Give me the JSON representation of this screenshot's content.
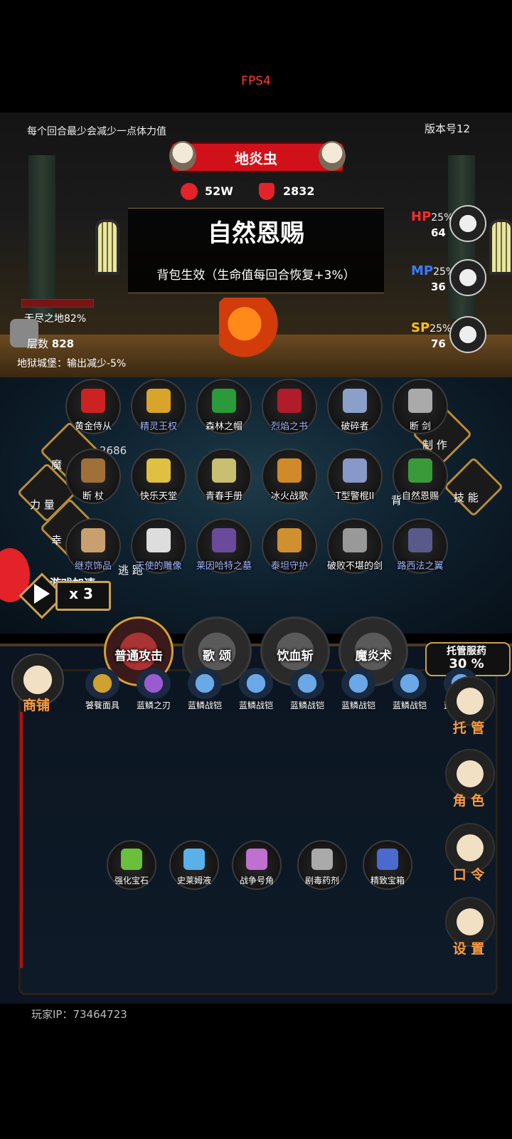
{
  "fps": "FPS4",
  "header": {
    "tip": "每个回合最少会减少一点体力值",
    "version": "版本号12"
  },
  "boss": {
    "name": "地炎虫",
    "hp": "52W",
    "def": "2832"
  },
  "buff": {
    "title": "自然恩赐",
    "desc": "背包生效（生命值每回合恢复+3%）"
  },
  "resources": {
    "hp": {
      "label": "HP",
      "pct": "25%",
      "value": "64",
      "color": "#ff2a2a"
    },
    "mp": {
      "label": "MP",
      "pct": "25%",
      "value": "36",
      "color": "#3a7bff"
    },
    "sp": {
      "label": "SP",
      "pct": "25%",
      "value": "76",
      "color": "#ffc21a"
    }
  },
  "zone": {
    "name": "无尽之地82%",
    "floor_label": "层数",
    "floor_value": "828",
    "castle": "地狱城堡：输出减少-5%"
  },
  "items": [
    {
      "label": "黄金侍从",
      "blue": false,
      "color": "#c22"
    },
    {
      "label": "精灵王权",
      "blue": true,
      "color": "#d9a42a"
    },
    {
      "label": "森林之帽",
      "blue": false,
      "color": "#2a9a3a"
    },
    {
      "label": "烈焰之书",
      "blue": true,
      "color": "#b01c2a"
    },
    {
      "label": "破碎者",
      "blue": false,
      "color": "#8aa0c8"
    },
    {
      "label": "断 剑",
      "blue": false,
      "color": "#aaa"
    },
    {
      "label": "断 杖",
      "blue": false,
      "color": "#a0703a"
    },
    {
      "label": "快乐天堂",
      "blue": false,
      "color": "#e0c040"
    },
    {
      "label": "青春手册",
      "blue": false,
      "color": "#c8c070"
    },
    {
      "label": "冰火战歌",
      "blue": false,
      "color": "#d08a2a"
    },
    {
      "label": "T型警棍II",
      "blue": false,
      "color": "#8898c8"
    },
    {
      "label": "自然恩赐",
      "blue": false,
      "color": "#3a9a3a"
    },
    {
      "label": "继京饰品",
      "blue": true,
      "color": "#c8a070"
    },
    {
      "label": "天使的雕像",
      "blue": true,
      "color": "#ddd"
    },
    {
      "label": "莱因哈特之墓",
      "blue": true,
      "color": "#6a4a9a"
    },
    {
      "label": "泰坦守护",
      "blue": true,
      "color": "#d09030"
    },
    {
      "label": "破败不堪的剑",
      "blue": false,
      "color": "#999"
    },
    {
      "label": "路西法之翼",
      "blue": true,
      "color": "#5a5a8a"
    }
  ],
  "side": {
    "craft": "制 作",
    "skill": "技 能",
    "bag": "背",
    "magic": "魔",
    "power": "力 量",
    "luck": "幸",
    "escape": "逃 跑",
    "number": "2686",
    "speed_label": "游戏加速",
    "speed_value": "x 3"
  },
  "skills": [
    {
      "label": "普通攻击"
    },
    {
      "label": "歌 颂"
    },
    {
      "label": "饮血斩"
    },
    {
      "label": "魔炎术"
    }
  ],
  "auto_med": {
    "title": "托管服药",
    "value": "30 %"
  },
  "equip_slots": [
    {
      "label": "饕餮面具",
      "color": "#d0a030"
    },
    {
      "label": "蓝鳞之刃",
      "color": "#9a5ad0"
    },
    {
      "label": "蓝鳞战铠",
      "color": "#6aa8e8"
    },
    {
      "label": "蓝鳞战铠",
      "color": "#6aa8e8"
    },
    {
      "label": "蓝鳞战铠",
      "color": "#6aa8e8"
    },
    {
      "label": "蓝鳞战铠",
      "color": "#6aa8e8"
    },
    {
      "label": "蓝鳞战铠",
      "color": "#6aa8e8"
    },
    {
      "label": "蓝鳞战铠",
      "color": "#6aa8e8"
    }
  ],
  "bag_items": [
    {
      "label": "强化宝石",
      "color": "#6ac03a"
    },
    {
      "label": "史莱姆液",
      "color": "#5ab0e8"
    },
    {
      "label": "战争号角",
      "color": "#c070d0"
    },
    {
      "label": "剧毒药剂",
      "color": "#aaa"
    },
    {
      "label": "精致宝箱",
      "color": "#4a6ad0"
    }
  ],
  "shop": "商铺",
  "menu": [
    "托 管",
    "角 色",
    "口 令",
    "设 置"
  ],
  "player_ip": "玩家IP：73464723"
}
